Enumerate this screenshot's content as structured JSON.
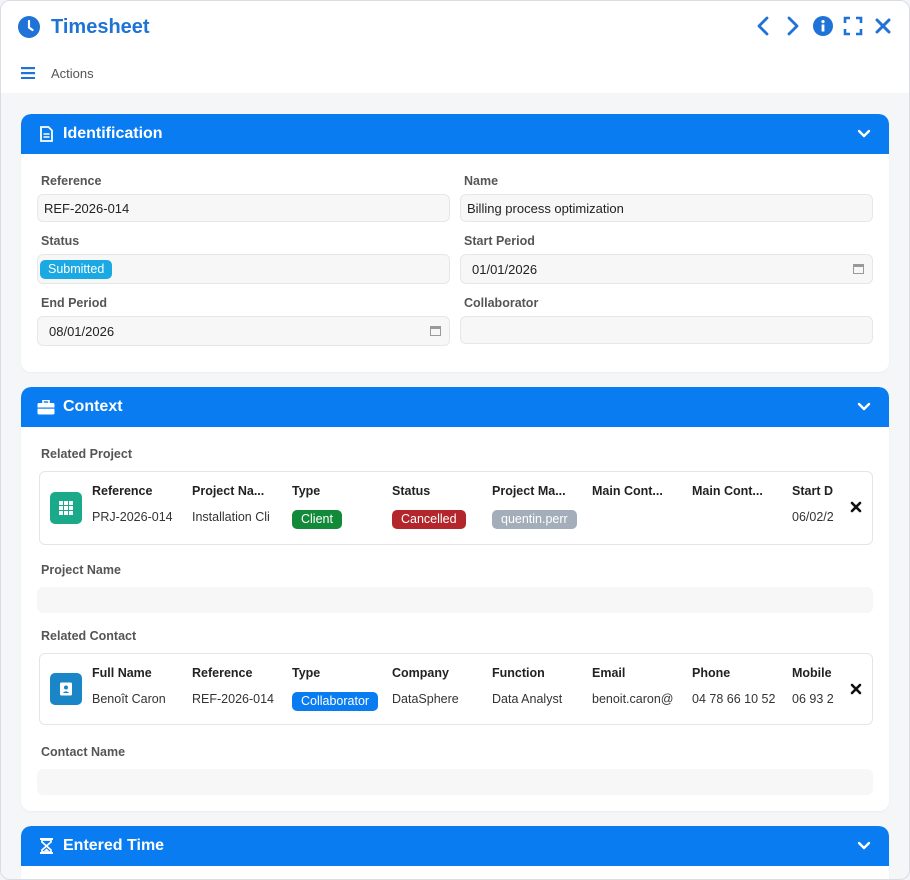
{
  "app": {
    "title": "Timesheet"
  },
  "actions": {
    "label": "Actions"
  },
  "identification": {
    "title": "Identification",
    "reference_label": "Reference",
    "reference_value": "REF-2026-014",
    "name_label": "Name",
    "name_value": "Billing process optimization",
    "status_label": "Status",
    "status_value": "Submitted",
    "start_label": "Start Period",
    "start_value": "01/01/2026",
    "end_label": "End Period",
    "end_value": "08/01/2026",
    "collaborator_label": "Collaborator",
    "collaborator_value": ""
  },
  "context": {
    "title": "Context",
    "related_project_label": "Related Project",
    "project": {
      "headers": [
        "Reference",
        "Project Na...",
        "Type",
        "Status",
        "Project Ma...",
        "Main Cont...",
        "Main Cont...",
        "Start D"
      ],
      "reference": "PRJ-2026-014",
      "name": "Installation Cli",
      "type": "Client",
      "status": "Cancelled",
      "manager": "quentin.perr",
      "main_contact_1": "",
      "main_contact_2": "",
      "start": "06/02/2"
    },
    "project_name_label": "Project Name",
    "project_name_value": "",
    "related_contact_label": "Related Contact",
    "contact": {
      "headers": [
        "Full Name",
        "Reference",
        "Type",
        "Company",
        "Function",
        "Email",
        "Phone",
        "Mobile"
      ],
      "full_name": "Benoît Caron",
      "reference": "REF-2026-014",
      "type": "Collaborator",
      "company": "DataSphere",
      "function": "Data Analyst",
      "email": "benoit.caron@",
      "phone": "04 78 66 10 52",
      "mobile": "06 93 2"
    },
    "contact_name_label": "Contact Name",
    "contact_name_value": ""
  },
  "entered_time": {
    "title": "Entered Time"
  },
  "colors": {
    "accent": "#0a7cf2",
    "title": "#1f73d6",
    "submitted": "#1ba9e3",
    "client": "#128a3a",
    "cancelled": "#b3262b",
    "manager_badge": "#a4adba",
    "project_icon_bg": "#1aaa8a",
    "contact_icon_bg": "#1a86c8"
  },
  "icons": {
    "app": "clock-icon",
    "prev": "chevron-left-icon",
    "next": "chevron-right-icon",
    "info": "info-icon",
    "expand": "expand-icon",
    "close": "close-icon",
    "menu": "menu-icon",
    "identification": "document-icon",
    "context": "briefcase-icon",
    "entered_time": "hourglass-icon",
    "project": "grid-icon",
    "contact": "contact-card-icon"
  }
}
